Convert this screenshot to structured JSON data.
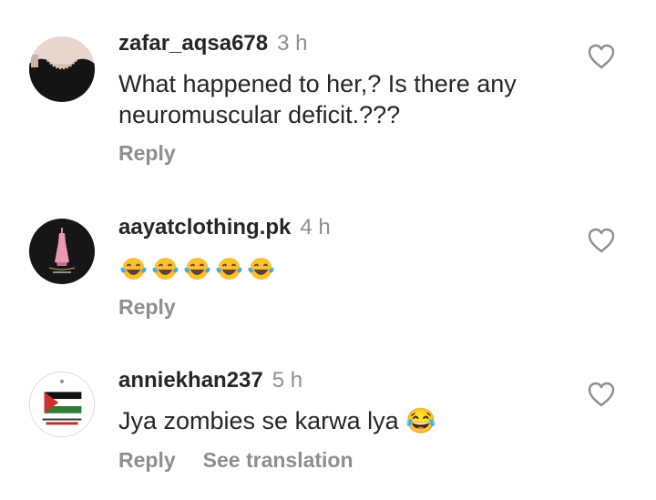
{
  "comments": [
    {
      "username": "zafar_aqsa678",
      "time": "3 h",
      "text": "What happened to her,? Is there any neuromuscular deficit.???",
      "reply_label": "Reply",
      "avatar_icon": "profile-photo-black-dress"
    },
    {
      "username": "aayatclothing.pk",
      "time": "4 h",
      "text": "😂😂😂😂😂",
      "reply_label": "Reply",
      "avatar_icon": "aayat-clothing-logo"
    },
    {
      "username": "anniekhan237",
      "time": "5 h",
      "text": "Jya zombies se karwa lya 😂",
      "reply_label": "Reply",
      "see_translation_label": "See translation",
      "avatar_icon": "palestine-flag-badge"
    }
  ],
  "icons": {
    "like": "heart-outline-icon",
    "emoji": "face-with-tears-of-joy"
  },
  "colors": {
    "username": "#262626",
    "secondary": "#8e8e8e",
    "heart_outline": "#8e8e8e"
  }
}
